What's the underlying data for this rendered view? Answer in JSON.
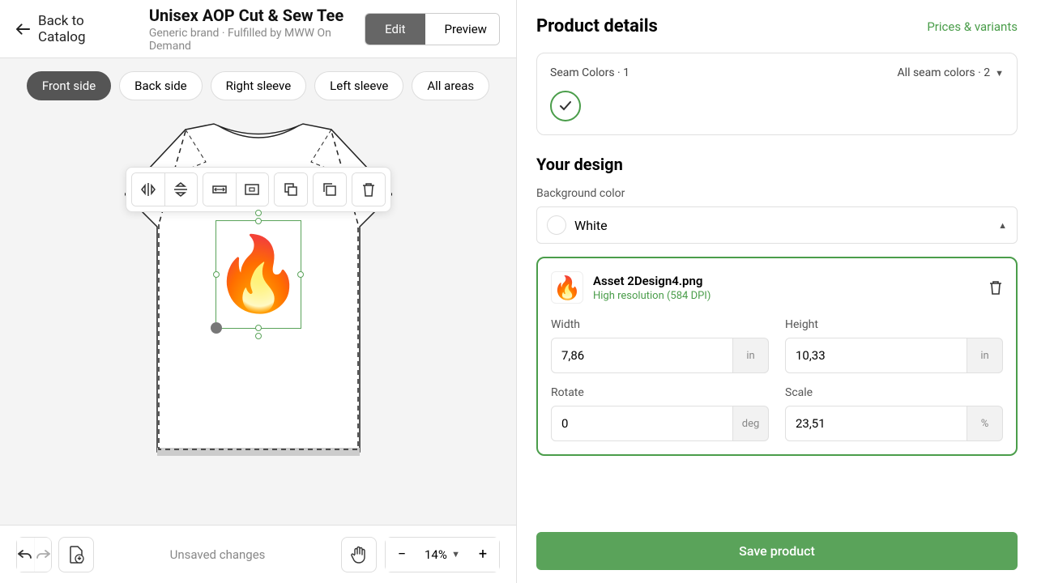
{
  "header": {
    "back": "Back to Catalog",
    "title": "Unisex AOP Cut & Sew Tee",
    "subtitle": "Generic brand · Fulfilled by MWW On Demand",
    "edit": "Edit",
    "preview": "Preview"
  },
  "tabs": [
    "Front side",
    "Back side",
    "Right sleeve",
    "Left sleeve",
    "All areas"
  ],
  "toolbar": {
    "icons": [
      "flip-h",
      "flip-v",
      "fit-width",
      "fit-area",
      "bring-front",
      "duplicate",
      "delete"
    ]
  },
  "bottom": {
    "status": "Unsaved changes",
    "zoom": "14%"
  },
  "right": {
    "title": "Product details",
    "prices": "Prices & variants",
    "seam": {
      "label": "Seam Colors · 1",
      "all": "All seam colors · 2"
    },
    "design": {
      "title": "Your design",
      "bg_label": "Background color",
      "bg_value": "White",
      "asset_name": "Asset 2Design4.png",
      "asset_res": "High resolution (584 DPI)",
      "width_label": "Width",
      "width_val": "7,86",
      "width_unit": "in",
      "height_label": "Height",
      "height_val": "10,33",
      "height_unit": "in",
      "rotate_label": "Rotate",
      "rotate_val": "0",
      "rotate_unit": "deg",
      "scale_label": "Scale",
      "scale_val": "23,51",
      "scale_unit": "%"
    },
    "save": "Save product"
  }
}
